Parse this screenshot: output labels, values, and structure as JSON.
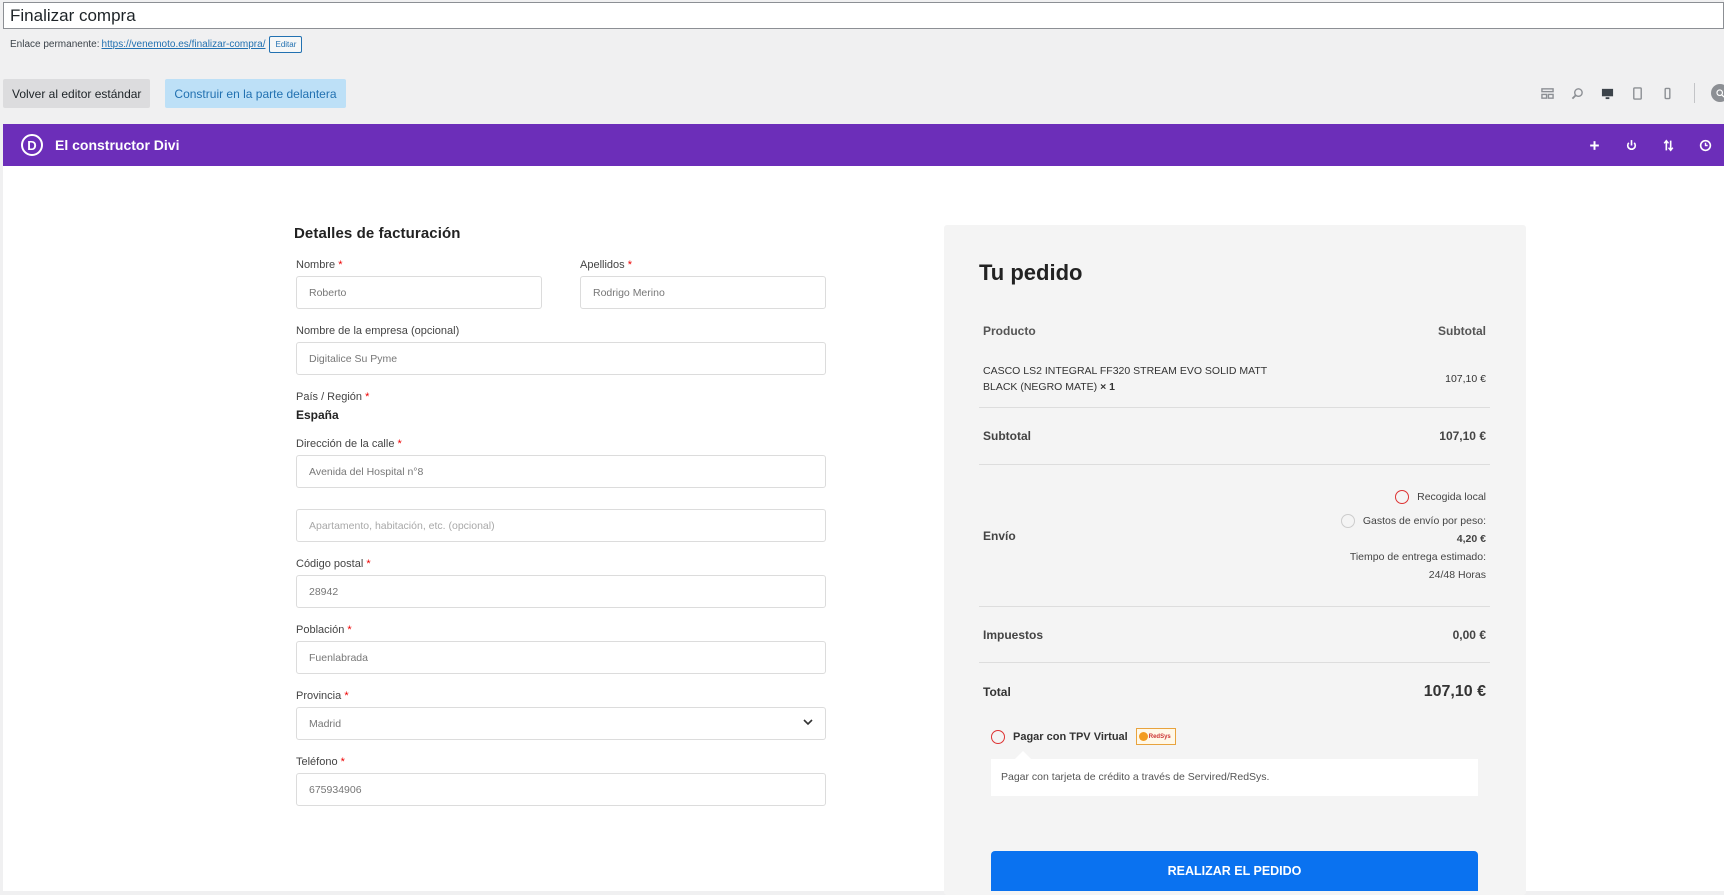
{
  "page_title": "Finalizar compra",
  "permalink": {
    "label": "Enlace permanente:",
    "url": "https://venemoto.es/finalizar-compra/",
    "edit": "Editar"
  },
  "buttons": {
    "standard_editor": "Volver al editor estándar",
    "frontend_build": "Construir en la parte delantera"
  },
  "divi": {
    "logo": "D",
    "title": "El constructor Divi"
  },
  "billing": {
    "heading": "Detalles de facturación",
    "first_name": {
      "label": "Nombre",
      "value": "Roberto"
    },
    "last_name": {
      "label": "Apellidos",
      "value": "Rodrigo Merino"
    },
    "company": {
      "label": "Nombre de la empresa (opcional)",
      "value": "Digitalice Su Pyme"
    },
    "country": {
      "label": "País / Región",
      "value": "España"
    },
    "street": {
      "label": "Dirección de la calle",
      "value": "Avenida del Hospital n°8",
      "placeholder2": "Apartamento, habitación, etc. (opcional)"
    },
    "postcode": {
      "label": "Código postal",
      "value": "28942"
    },
    "city": {
      "label": "Población",
      "value": "Fuenlabrada"
    },
    "province": {
      "label": "Provincia",
      "value": "Madrid"
    },
    "phone": {
      "label": "Teléfono",
      "value": "675934906"
    },
    "required_mark": "*"
  },
  "order": {
    "heading": "Tu pedido",
    "col_product": "Producto",
    "col_subtotal": "Subtotal",
    "product_name": "CASCO LS2 INTEGRAL FF320 STREAM EVO SOLID MATT BLACK (NEGRO MATE)",
    "product_qty": "× 1",
    "product_price": "107,10 €",
    "subtotal_label": "Subtotal",
    "subtotal_value": "107,10 €",
    "shipping_label": "Envío",
    "ship_option1": "Recogida local",
    "ship_option2": "Gastos de envío por peso:",
    "ship_option2_price": "4,20 €",
    "ship_time_label": "Tiempo de entrega estimado:",
    "ship_time_value": "24/48 Horas",
    "tax_label": "Impuestos",
    "tax_value": "0,00 €",
    "total_label": "Total",
    "total_value": "107,10 €",
    "payment_method": "Pagar con TPV Virtual",
    "payment_logo": "RedSys",
    "payment_desc": "Pagar con tarjeta de crédito a través de Servired/RedSys.",
    "place_order": "REALIZAR EL PEDIDO"
  },
  "colors": {
    "divi_purple": "#6c2eb9",
    "place_order_blue": "#0a72f0",
    "required_red": "#ee0000"
  }
}
